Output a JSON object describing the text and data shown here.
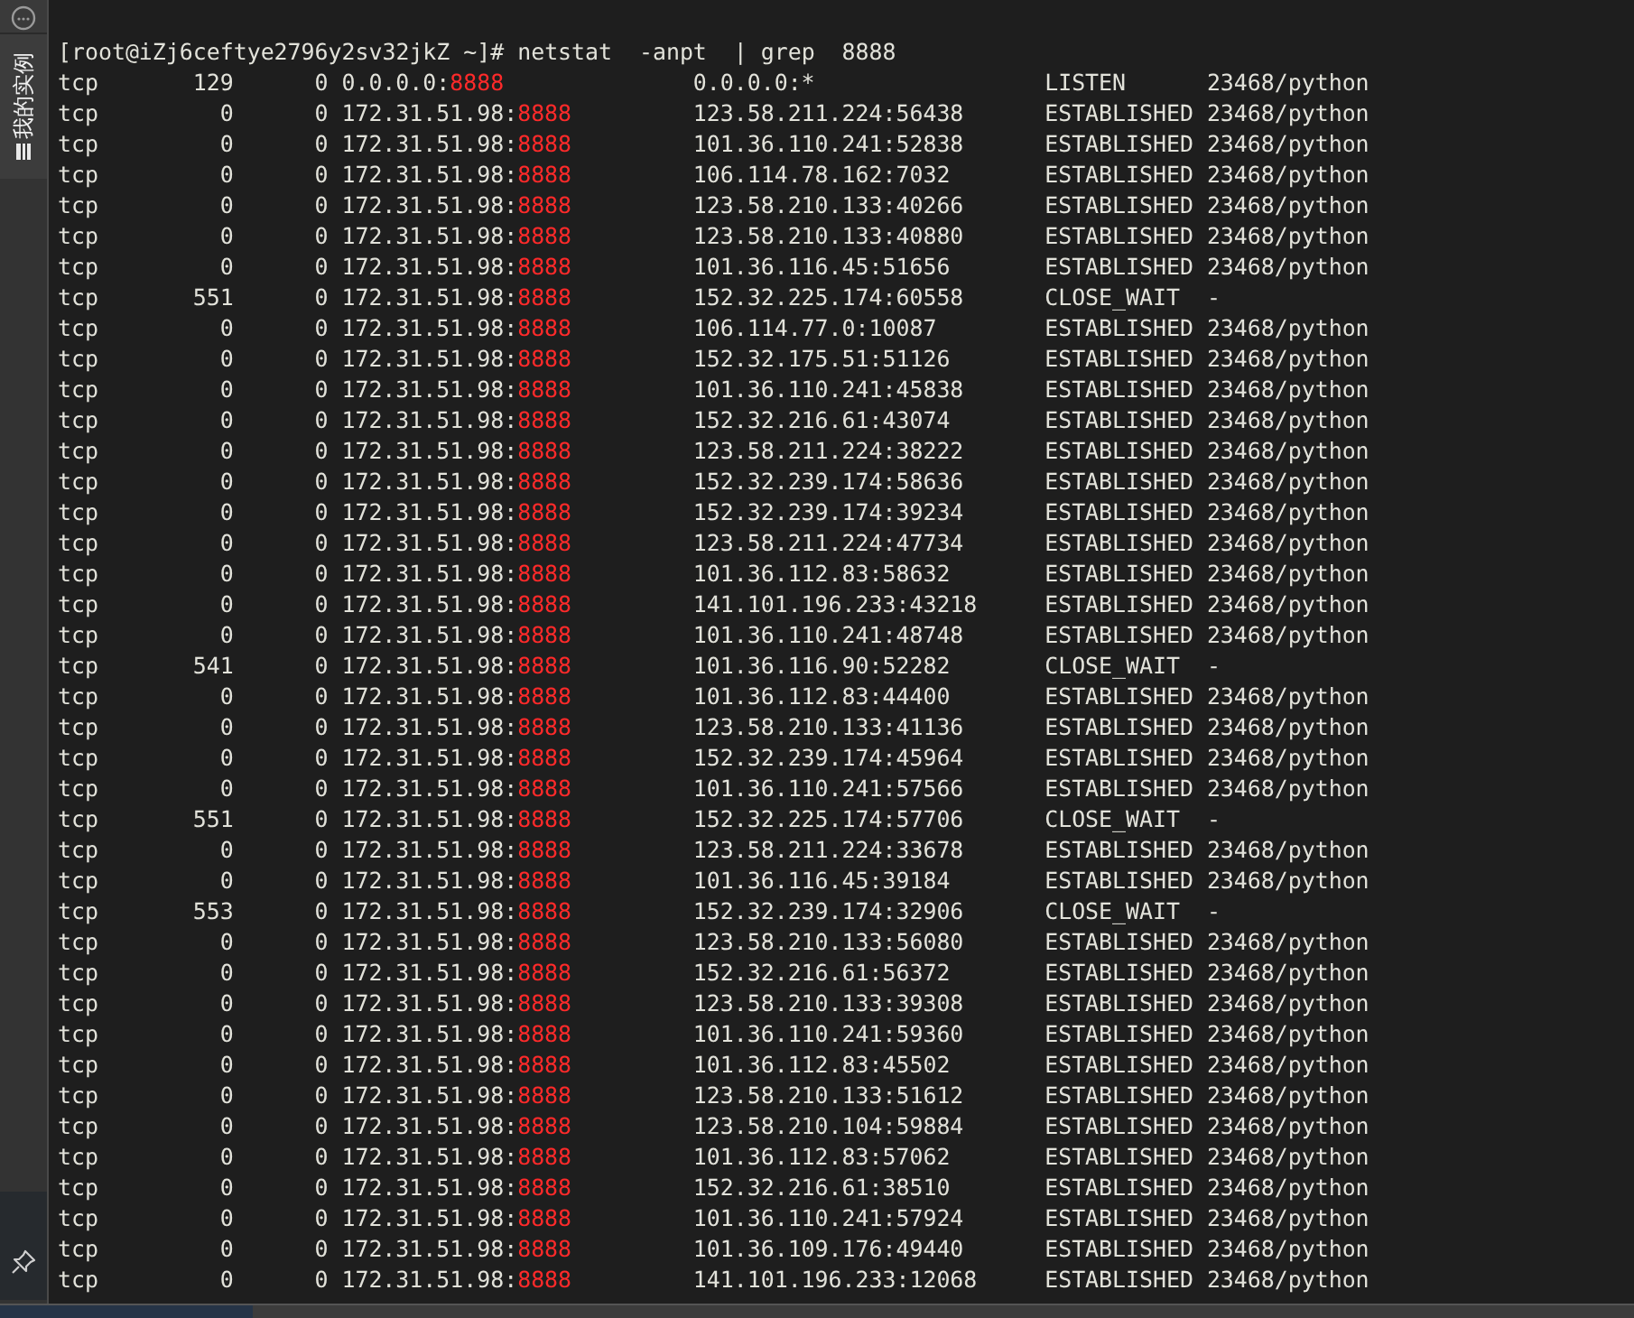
{
  "sidebar": {
    "tab_label": "我的实例"
  },
  "terminal": {
    "command_line": "[root@iZj6ceftye2796y2sv32jkZ ~]# netstat  -anpt  | grep  8888",
    "rows": [
      {
        "proto": "tcp",
        "recv_q": "129",
        "send_q": "0",
        "local_host": "0.0.0.0:",
        "local_port": "8888",
        "foreign_address": "0.0.0.0:*",
        "state": "LISTEN",
        "pid_program": "23468/python"
      },
      {
        "proto": "tcp",
        "recv_q": "0",
        "send_q": "0",
        "local_host": "172.31.51.98:",
        "local_port": "8888",
        "foreign_address": "123.58.211.224:56438",
        "state": "ESTABLISHED",
        "pid_program": "23468/python"
      },
      {
        "proto": "tcp",
        "recv_q": "0",
        "send_q": "0",
        "local_host": "172.31.51.98:",
        "local_port": "8888",
        "foreign_address": "101.36.110.241:52838",
        "state": "ESTABLISHED",
        "pid_program": "23468/python"
      },
      {
        "proto": "tcp",
        "recv_q": "0",
        "send_q": "0",
        "local_host": "172.31.51.98:",
        "local_port": "8888",
        "foreign_address": "106.114.78.162:7032",
        "state": "ESTABLISHED",
        "pid_program": "23468/python"
      },
      {
        "proto": "tcp",
        "recv_q": "0",
        "send_q": "0",
        "local_host": "172.31.51.98:",
        "local_port": "8888",
        "foreign_address": "123.58.210.133:40266",
        "state": "ESTABLISHED",
        "pid_program": "23468/python"
      },
      {
        "proto": "tcp",
        "recv_q": "0",
        "send_q": "0",
        "local_host": "172.31.51.98:",
        "local_port": "8888",
        "foreign_address": "123.58.210.133:40880",
        "state": "ESTABLISHED",
        "pid_program": "23468/python"
      },
      {
        "proto": "tcp",
        "recv_q": "0",
        "send_q": "0",
        "local_host": "172.31.51.98:",
        "local_port": "8888",
        "foreign_address": "101.36.116.45:51656",
        "state": "ESTABLISHED",
        "pid_program": "23468/python"
      },
      {
        "proto": "tcp",
        "recv_q": "551",
        "send_q": "0",
        "local_host": "172.31.51.98:",
        "local_port": "8888",
        "foreign_address": "152.32.225.174:60558",
        "state": "CLOSE_WAIT",
        "pid_program": "-"
      },
      {
        "proto": "tcp",
        "recv_q": "0",
        "send_q": "0",
        "local_host": "172.31.51.98:",
        "local_port": "8888",
        "foreign_address": "106.114.77.0:10087",
        "state": "ESTABLISHED",
        "pid_program": "23468/python"
      },
      {
        "proto": "tcp",
        "recv_q": "0",
        "send_q": "0",
        "local_host": "172.31.51.98:",
        "local_port": "8888",
        "foreign_address": "152.32.175.51:51126",
        "state": "ESTABLISHED",
        "pid_program": "23468/python"
      },
      {
        "proto": "tcp",
        "recv_q": "0",
        "send_q": "0",
        "local_host": "172.31.51.98:",
        "local_port": "8888",
        "foreign_address": "101.36.110.241:45838",
        "state": "ESTABLISHED",
        "pid_program": "23468/python"
      },
      {
        "proto": "tcp",
        "recv_q": "0",
        "send_q": "0",
        "local_host": "172.31.51.98:",
        "local_port": "8888",
        "foreign_address": "152.32.216.61:43074",
        "state": "ESTABLISHED",
        "pid_program": "23468/python"
      },
      {
        "proto": "tcp",
        "recv_q": "0",
        "send_q": "0",
        "local_host": "172.31.51.98:",
        "local_port": "8888",
        "foreign_address": "123.58.211.224:38222",
        "state": "ESTABLISHED",
        "pid_program": "23468/python"
      },
      {
        "proto": "tcp",
        "recv_q": "0",
        "send_q": "0",
        "local_host": "172.31.51.98:",
        "local_port": "8888",
        "foreign_address": "152.32.239.174:58636",
        "state": "ESTABLISHED",
        "pid_program": "23468/python"
      },
      {
        "proto": "tcp",
        "recv_q": "0",
        "send_q": "0",
        "local_host": "172.31.51.98:",
        "local_port": "8888",
        "foreign_address": "152.32.239.174:39234",
        "state": "ESTABLISHED",
        "pid_program": "23468/python"
      },
      {
        "proto": "tcp",
        "recv_q": "0",
        "send_q": "0",
        "local_host": "172.31.51.98:",
        "local_port": "8888",
        "foreign_address": "123.58.211.224:47734",
        "state": "ESTABLISHED",
        "pid_program": "23468/python"
      },
      {
        "proto": "tcp",
        "recv_q": "0",
        "send_q": "0",
        "local_host": "172.31.51.98:",
        "local_port": "8888",
        "foreign_address": "101.36.112.83:58632",
        "state": "ESTABLISHED",
        "pid_program": "23468/python"
      },
      {
        "proto": "tcp",
        "recv_q": "0",
        "send_q": "0",
        "local_host": "172.31.51.98:",
        "local_port": "8888",
        "foreign_address": "141.101.196.233:43218",
        "state": "ESTABLISHED",
        "pid_program": "23468/python"
      },
      {
        "proto": "tcp",
        "recv_q": "0",
        "send_q": "0",
        "local_host": "172.31.51.98:",
        "local_port": "8888",
        "foreign_address": "101.36.110.241:48748",
        "state": "ESTABLISHED",
        "pid_program": "23468/python"
      },
      {
        "proto": "tcp",
        "recv_q": "541",
        "send_q": "0",
        "local_host": "172.31.51.98:",
        "local_port": "8888",
        "foreign_address": "101.36.116.90:52282",
        "state": "CLOSE_WAIT",
        "pid_program": "-"
      },
      {
        "proto": "tcp",
        "recv_q": "0",
        "send_q": "0",
        "local_host": "172.31.51.98:",
        "local_port": "8888",
        "foreign_address": "101.36.112.83:44400",
        "state": "ESTABLISHED",
        "pid_program": "23468/python"
      },
      {
        "proto": "tcp",
        "recv_q": "0",
        "send_q": "0",
        "local_host": "172.31.51.98:",
        "local_port": "8888",
        "foreign_address": "123.58.210.133:41136",
        "state": "ESTABLISHED",
        "pid_program": "23468/python"
      },
      {
        "proto": "tcp",
        "recv_q": "0",
        "send_q": "0",
        "local_host": "172.31.51.98:",
        "local_port": "8888",
        "foreign_address": "152.32.239.174:45964",
        "state": "ESTABLISHED",
        "pid_program": "23468/python"
      },
      {
        "proto": "tcp",
        "recv_q": "0",
        "send_q": "0",
        "local_host": "172.31.51.98:",
        "local_port": "8888",
        "foreign_address": "101.36.110.241:57566",
        "state": "ESTABLISHED",
        "pid_program": "23468/python"
      },
      {
        "proto": "tcp",
        "recv_q": "551",
        "send_q": "0",
        "local_host": "172.31.51.98:",
        "local_port": "8888",
        "foreign_address": "152.32.225.174:57706",
        "state": "CLOSE_WAIT",
        "pid_program": "-"
      },
      {
        "proto": "tcp",
        "recv_q": "0",
        "send_q": "0",
        "local_host": "172.31.51.98:",
        "local_port": "8888",
        "foreign_address": "123.58.211.224:33678",
        "state": "ESTABLISHED",
        "pid_program": "23468/python"
      },
      {
        "proto": "tcp",
        "recv_q": "0",
        "send_q": "0",
        "local_host": "172.31.51.98:",
        "local_port": "8888",
        "foreign_address": "101.36.116.45:39184",
        "state": "ESTABLISHED",
        "pid_program": "23468/python"
      },
      {
        "proto": "tcp",
        "recv_q": "553",
        "send_q": "0",
        "local_host": "172.31.51.98:",
        "local_port": "8888",
        "foreign_address": "152.32.239.174:32906",
        "state": "CLOSE_WAIT",
        "pid_program": "-"
      },
      {
        "proto": "tcp",
        "recv_q": "0",
        "send_q": "0",
        "local_host": "172.31.51.98:",
        "local_port": "8888",
        "foreign_address": "123.58.210.133:56080",
        "state": "ESTABLISHED",
        "pid_program": "23468/python"
      },
      {
        "proto": "tcp",
        "recv_q": "0",
        "send_q": "0",
        "local_host": "172.31.51.98:",
        "local_port": "8888",
        "foreign_address": "152.32.216.61:56372",
        "state": "ESTABLISHED",
        "pid_program": "23468/python"
      },
      {
        "proto": "tcp",
        "recv_q": "0",
        "send_q": "0",
        "local_host": "172.31.51.98:",
        "local_port": "8888",
        "foreign_address": "123.58.210.133:39308",
        "state": "ESTABLISHED",
        "pid_program": "23468/python"
      },
      {
        "proto": "tcp",
        "recv_q": "0",
        "send_q": "0",
        "local_host": "172.31.51.98:",
        "local_port": "8888",
        "foreign_address": "101.36.110.241:59360",
        "state": "ESTABLISHED",
        "pid_program": "23468/python"
      },
      {
        "proto": "tcp",
        "recv_q": "0",
        "send_q": "0",
        "local_host": "172.31.51.98:",
        "local_port": "8888",
        "foreign_address": "101.36.112.83:45502",
        "state": "ESTABLISHED",
        "pid_program": "23468/python"
      },
      {
        "proto": "tcp",
        "recv_q": "0",
        "send_q": "0",
        "local_host": "172.31.51.98:",
        "local_port": "8888",
        "foreign_address": "123.58.210.133:51612",
        "state": "ESTABLISHED",
        "pid_program": "23468/python"
      },
      {
        "proto": "tcp",
        "recv_q": "0",
        "send_q": "0",
        "local_host": "172.31.51.98:",
        "local_port": "8888",
        "foreign_address": "123.58.210.104:59884",
        "state": "ESTABLISHED",
        "pid_program": "23468/python"
      },
      {
        "proto": "tcp",
        "recv_q": "0",
        "send_q": "0",
        "local_host": "172.31.51.98:",
        "local_port": "8888",
        "foreign_address": "101.36.112.83:57062",
        "state": "ESTABLISHED",
        "pid_program": "23468/python"
      },
      {
        "proto": "tcp",
        "recv_q": "0",
        "send_q": "0",
        "local_host": "172.31.51.98:",
        "local_port": "8888",
        "foreign_address": "152.32.216.61:38510",
        "state": "ESTABLISHED",
        "pid_program": "23468/python"
      },
      {
        "proto": "tcp",
        "recv_q": "0",
        "send_q": "0",
        "local_host": "172.31.51.98:",
        "local_port": "8888",
        "foreign_address": "101.36.110.241:57924",
        "state": "ESTABLISHED",
        "pid_program": "23468/python"
      },
      {
        "proto": "tcp",
        "recv_q": "0",
        "send_q": "0",
        "local_host": "172.31.51.98:",
        "local_port": "8888",
        "foreign_address": "101.36.109.176:49440",
        "state": "ESTABLISHED",
        "pid_program": "23468/python"
      },
      {
        "proto": "tcp",
        "recv_q": "0",
        "send_q": "0",
        "local_host": "172.31.51.98:",
        "local_port": "8888",
        "foreign_address": "141.101.196.233:12068",
        "state": "ESTABLISHED",
        "pid_program": "23468/python"
      }
    ]
  }
}
